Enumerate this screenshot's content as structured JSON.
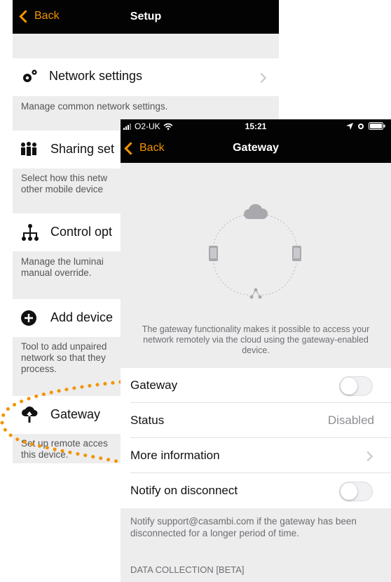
{
  "setup": {
    "back_label": "Back",
    "title": "Setup",
    "items": [
      {
        "title": "Network settings",
        "description": "Manage common network settings.",
        "icon": "gear-icon"
      },
      {
        "title": "Sharing set",
        "description": "Select how this netw\nother mobile device",
        "icon": "users-icon"
      },
      {
        "title": "Control opt",
        "description": "Manage the luminai\nmanual override.",
        "icon": "hierarchy-icon"
      },
      {
        "title": "Add device",
        "description": "Tool to add unpaired\nnetwork so that they\nprocess.",
        "icon": "plus-circle-icon"
      },
      {
        "title": "Gateway",
        "description": "Set up remote acces\nthis device.",
        "icon": "cloud-upload-icon"
      }
    ]
  },
  "gateway": {
    "status_bar": {
      "carrier": "O2-UK",
      "time": "15:21"
    },
    "back_label": "Back",
    "title": "Gateway",
    "illustration_caption": "The gateway functionality makes it possible to access your network remotely via the cloud using the gateway-enabled device.",
    "rows": {
      "gateway_label": "Gateway",
      "gateway_enabled": false,
      "status_label": "Status",
      "status_value": "Disabled",
      "more_info_label": "More information",
      "notify_label": "Notify on disconnect",
      "notify_enabled": false
    },
    "notify_description": "Notify support@casambi.com if the gateway has been disconnected for a longer period of time.",
    "section_header": "DATA COLLECTION [BETA]"
  },
  "colors": {
    "accent": "#f29400",
    "navbar": "#030303",
    "background": "#ededee"
  }
}
